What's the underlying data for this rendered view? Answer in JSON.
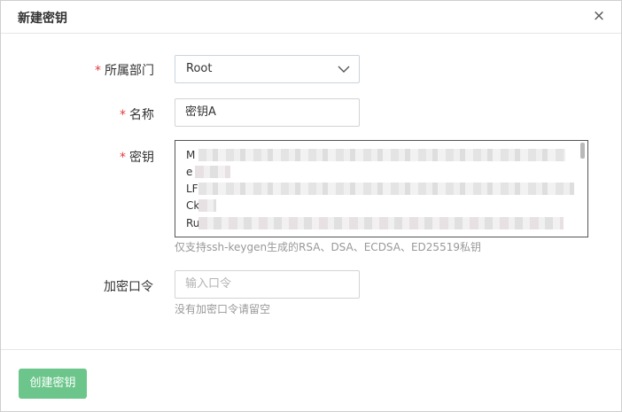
{
  "dialog": {
    "title": "新建密钥",
    "close_label": "×"
  },
  "form": {
    "department": {
      "required_mark": "*",
      "label": "所属部门",
      "value": "Root"
    },
    "name": {
      "required_mark": "*",
      "label": "名称",
      "value": "密钥A"
    },
    "key": {
      "required_mark": "*",
      "label": "密钥",
      "visible_line_starts": [
        "M",
        "e",
        "LF",
        "Ck",
        "Ru"
      ],
      "hint": "仅支持ssh-keygen生成的RSA、DSA、ECDSA、ED25519私钥"
    },
    "passphrase": {
      "label": "加密口令",
      "placeholder": "输入口令",
      "hint": "没有加密口令请留空"
    }
  },
  "footer": {
    "submit_label": "创建密钥"
  },
  "colors": {
    "required": "#e4393c",
    "primary_button": "#6cc68b"
  }
}
